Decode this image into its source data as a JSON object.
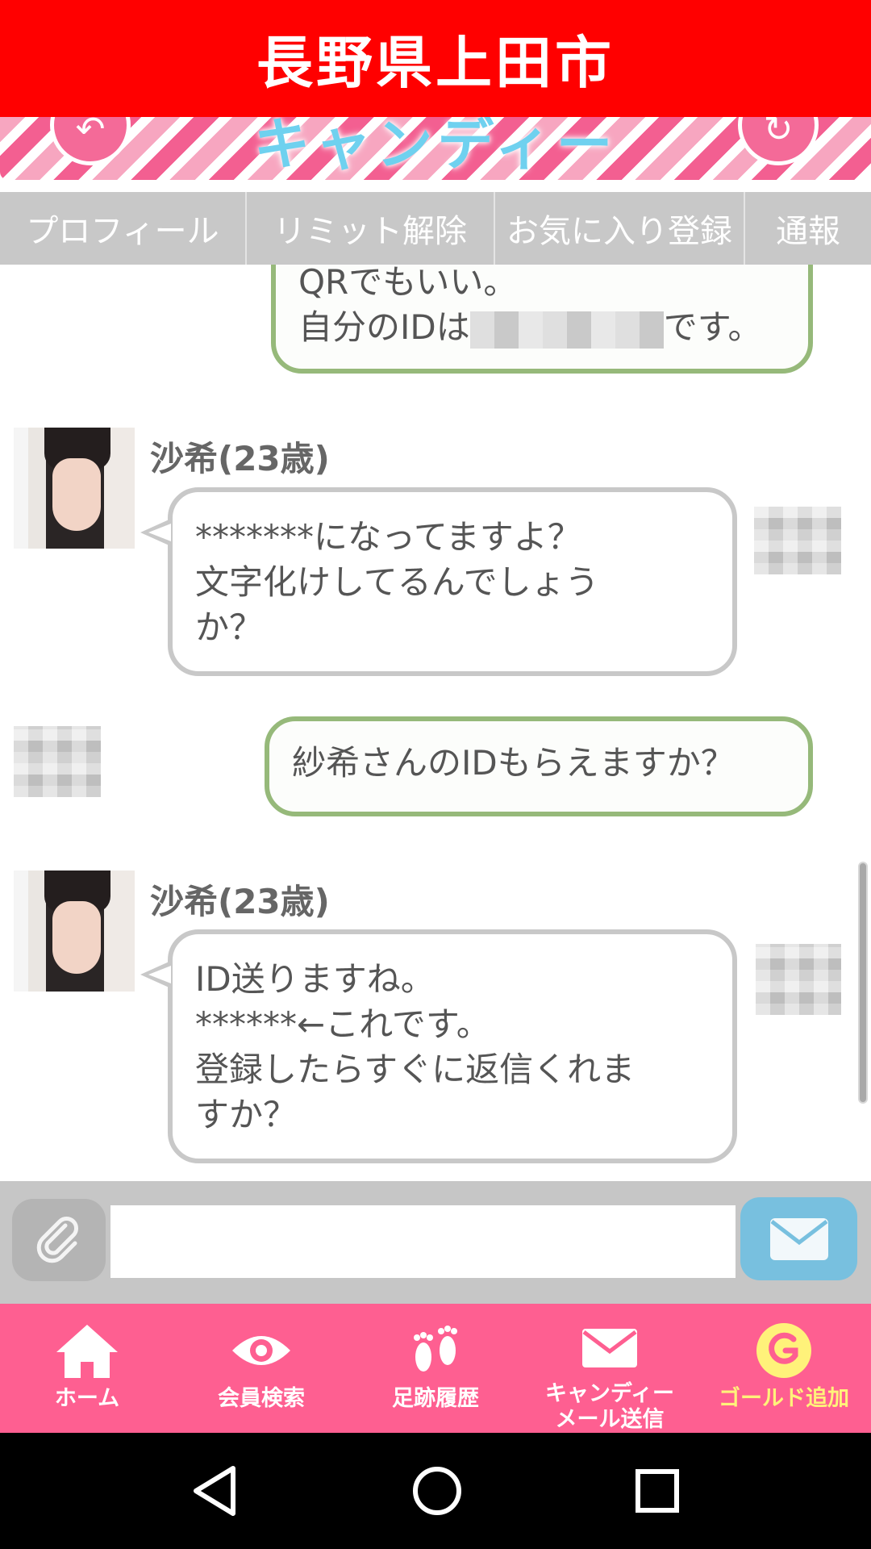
{
  "banner": {
    "title": "長野県上田市"
  },
  "app_header": {
    "logo_text": "キャンディー"
  },
  "tabs": [
    {
      "label": "プロフィール"
    },
    {
      "label": "リミット解除"
    },
    {
      "label": "お気に入り登録"
    },
    {
      "label": "通報"
    }
  ],
  "messages": [
    {
      "from": "me",
      "lines": [
        "QRでもいい。",
        "自分のIDは",
        "です。"
      ]
    },
    {
      "from": "them",
      "sender": "沙希(23歳)",
      "lines": [
        "*******になってますよ？",
        "文字化けしてるんでしょう",
        "か？"
      ]
    },
    {
      "from": "me",
      "lines": [
        "紗希さんのIDもらえますか？"
      ]
    },
    {
      "from": "them",
      "sender": "沙希(23歳)",
      "lines": [
        "ID送りますね。",
        "******←これです。",
        "登録したらすぐに返信くれま",
        "すか？"
      ]
    }
  ],
  "input": {
    "value": "",
    "placeholder": ""
  },
  "icons": {
    "attach": "paperclip-icon",
    "send": "envelope-icon",
    "back": "arrow-back-icon",
    "reload": "reload-icon"
  },
  "bottom_nav": [
    {
      "label": "ホーム",
      "icon": "home-icon"
    },
    {
      "label": "会員検索",
      "icon": "eye-icon"
    },
    {
      "label": "足跡履歴",
      "icon": "footprints-icon"
    },
    {
      "label": "キャンディー\nメール送信",
      "icon": "envelope-icon"
    },
    {
      "label": "ゴールド追加",
      "icon": "gold-coin-icon"
    }
  ],
  "colors": {
    "banner": "#ff0000",
    "nav": "#fe5f91",
    "my_bubble_border": "#96b97a",
    "their_bubble_border": "#c8c8c8",
    "send_button": "#78c0df",
    "gold_label": "#fff27a"
  }
}
